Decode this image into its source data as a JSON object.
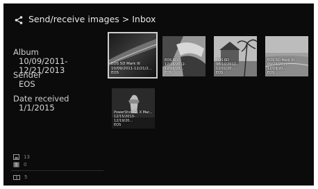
{
  "header": {
    "title": "Send/receive images > Inbox",
    "icon": "share-icon"
  },
  "info": {
    "album_label": "Album",
    "album_value": "10/09/2011-12/21/2013",
    "sender_label": "Sender",
    "sender_value": "EOS",
    "date_label": "Date received",
    "date_value": "1/1/2015"
  },
  "counts": {
    "images": "13",
    "movies": "0",
    "cards": "5"
  },
  "thumbnails": [
    {
      "model": "EOS 5D Mark III",
      "dates": "10/09/2011-12/21/2...",
      "sender": "EOS",
      "selected": true
    },
    {
      "model": "EOS 6D",
      "dates": "12/16/2012-12/16/20...",
      "sender": "EOS",
      "selected": false
    },
    {
      "model": "EOS 6D",
      "dates": "08/10/2012-12/21/20...",
      "sender": "EOS",
      "selected": false
    },
    {
      "model": "EOS 5D Mark III",
      "dates": "09/24/2011-12/19/20...",
      "sender": "EOS",
      "selected": false
    },
    {
      "model": "PowerShot G1 X Mar...",
      "dates": "12/15/2013-12/19/20...",
      "sender": "EOS",
      "selected": false
    }
  ]
}
